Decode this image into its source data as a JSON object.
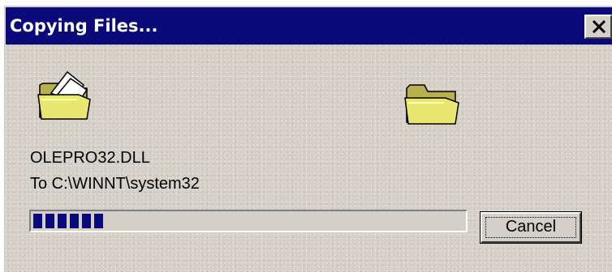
{
  "window": {
    "title": "Copying Files...",
    "close_icon": "close-x-icon"
  },
  "icons": {
    "source": "folder-with-papers-icon",
    "destination": "folder-icon",
    "folder_color": "#e8e870"
  },
  "status": {
    "file_name": "OLEPRO32.DLL",
    "destination_line": "To C:\\WINNT\\system32"
  },
  "progress": {
    "fraction": 0.18
  },
  "buttons": {
    "cancel_label": "Cancel"
  },
  "colors": {
    "titlebar": "#0a0a7a",
    "face": "#d4d0c8",
    "progress_block": "#0a0a7a"
  }
}
